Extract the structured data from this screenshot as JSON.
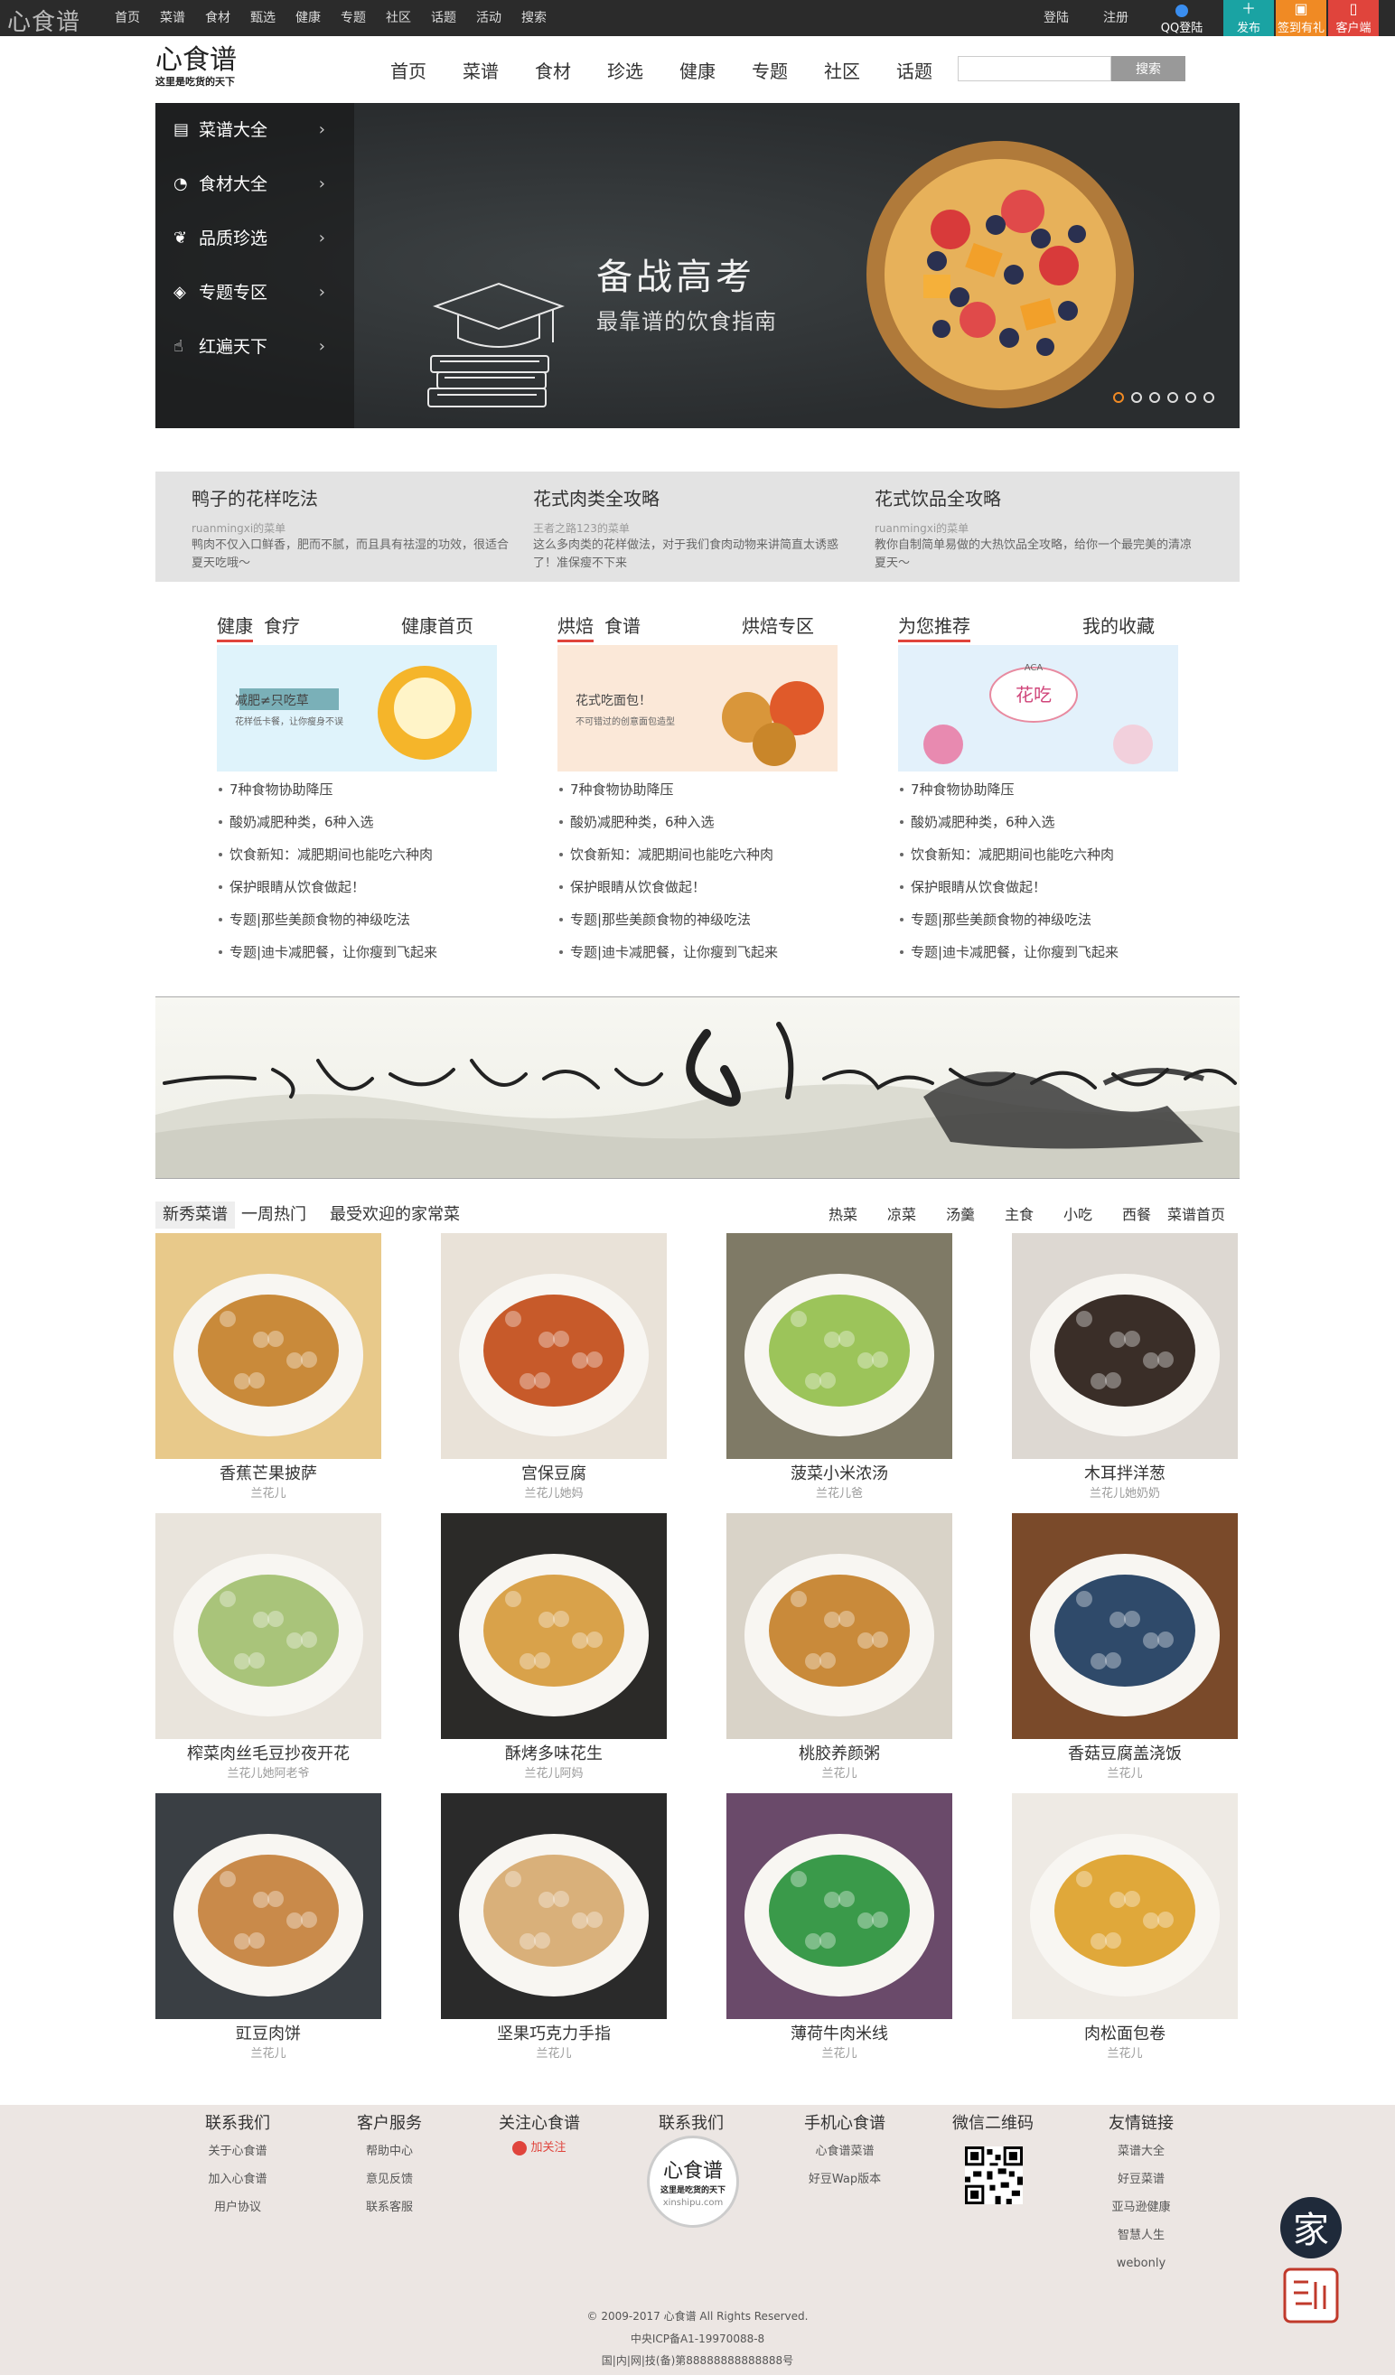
{
  "topbar": {
    "brand": "心食谱",
    "nav": [
      "首页",
      "菜谱",
      "食材",
      "甄选",
      "健康",
      "专题",
      "社区",
      "话题",
      "活动",
      "搜索"
    ],
    "login": "登陆",
    "register": "注册",
    "qq": "QQ登陆",
    "btn_publish": "发布",
    "btn_checkin": "签到有礼",
    "btn_client": "客户端"
  },
  "header": {
    "logo_text": "心食谱",
    "logo_slogan": "这里是吃货的天下",
    "nav": [
      "首页",
      "菜谱",
      "食材",
      "珍选",
      "健康",
      "专题",
      "社区",
      "话题"
    ],
    "search_placeholder": "",
    "search_button": "搜索"
  },
  "hero": {
    "menu": [
      {
        "label": "菜谱大全",
        "icon": "book-icon"
      },
      {
        "label": "食材大全",
        "icon": "apple-icon"
      },
      {
        "label": "品质珍选",
        "icon": "leaf-icon"
      },
      {
        "label": "专题专区",
        "icon": "diamond-icon"
      },
      {
        "label": "红遍天下",
        "icon": "thumbs-up-icon"
      }
    ],
    "title": "备战高考",
    "subtitle": "最靠谱的饮食指南",
    "slides": 6,
    "active_slide": 1
  },
  "articles": [
    {
      "title": "鸭子的花样吃法",
      "author": "ruanmingxi的菜单",
      "desc": "鸭肉不仅入口鲜香，肥而不腻，而且具有祛湿的功效，很适合夏天吃哦～"
    },
    {
      "title": "花式肉类全攻略",
      "author": "王者之路123的菜单",
      "desc": "这么多肉类的花样做法，对于我们食肉动物来讲简直太诱惑了！准保瘦不下来"
    },
    {
      "title": "花式饮品全攻略",
      "author": "ruanmingxi的菜单",
      "desc": "教你自制简单易做的大热饮品全攻略，给你一个最完美的清凉夏天～"
    }
  ],
  "columns": [
    {
      "tabs": [
        "健康",
        "食疗"
      ],
      "more": "健康首页",
      "banner": "减肥≠只吃草",
      "banner_sub": "花样低卡餐，让你瘦身不误",
      "items": [
        "7种食物协助降压",
        "酸奶减肥种类，6种入选",
        "饮食新知：减肥期间也能吃六种肉",
        "保护眼睛从饮食做起！",
        "专题|那些美颜食物的神级吃法",
        "专题|迪卡减肥餐，让你瘦到飞起来"
      ]
    },
    {
      "tabs": [
        "烘焙",
        "食谱"
      ],
      "more": "烘焙专区",
      "banner": "花式吃面包！",
      "banner_sub": "不可错过的创意面包造型",
      "items": [
        "7种食物协助降压",
        "酸奶减肥种类，6种入选",
        "饮食新知：减肥期间也能吃六种肉",
        "保护眼睛从饮食做起！",
        "专题|那些美颜食物的神级吃法",
        "专题|迪卡减肥餐，让你瘦到飞起来"
      ]
    },
    {
      "tabs": [
        "为您推荐"
      ],
      "more": "我的收藏",
      "banner": "花吃",
      "banner_sub": "ACA",
      "items": [
        "7种食物协助降压",
        "酸奶减肥种类，6种入选",
        "饮食新知：减肥期间也能吃六种肉",
        "保护眼睛从饮食做起！",
        "专题|那些美颜食物的神级吃法",
        "专题|迪卡减肥餐，让你瘦到飞起来"
      ]
    }
  ],
  "recipes_tabs": {
    "left": [
      "新秀菜谱",
      "一周热门",
      "最受欢迎的家常菜"
    ],
    "right": [
      "热菜",
      "凉菜",
      "汤羹",
      "主食",
      "小吃",
      "西餐",
      "菜谱首页"
    ]
  },
  "recipes": [
    {
      "name": "香蕉芒果披萨",
      "author": "兰花儿",
      "bg": "#e8c98a",
      "fg": "#c98a3a"
    },
    {
      "name": "宫保豆腐",
      "author": "兰花儿她妈",
      "bg": "#e9e2d8",
      "fg": "#c75a2a"
    },
    {
      "name": "菠菜小米浓汤",
      "author": "兰花儿爸",
      "bg": "#7f7a66",
      "fg": "#9cc45a"
    },
    {
      "name": "木耳拌洋葱",
      "author": "兰花儿她奶奶",
      "bg": "#ddd8d2",
      "fg": "#3a2e28"
    },
    {
      "name": "榨菜肉丝毛豆抄夜开花",
      "author": "兰花儿她阿老爷",
      "bg": "#e9e4dc",
      "fg": "#a9c47a"
    },
    {
      "name": "酥烤多味花生",
      "author": "兰花儿阿妈",
      "bg": "#2b2a28",
      "fg": "#d9a24a"
    },
    {
      "name": "桃胶养颜粥",
      "author": "兰花儿",
      "bg": "#d9d3c8",
      "fg": "#c98a3a"
    },
    {
      "name": "香菇豆腐盖浇饭",
      "author": "兰花儿",
      "bg": "#7a4a2a",
      "fg": "#2f4a6a"
    },
    {
      "name": "豇豆肉饼",
      "author": "兰花儿",
      "bg": "#3a3f44",
      "fg": "#c98a4a"
    },
    {
      "name": "坚果巧克力手指",
      "author": "兰花儿",
      "bg": "#2a2a2a",
      "fg": "#d9b07a"
    },
    {
      "name": "薄荷牛肉米线",
      "author": "兰花儿",
      "bg": "#6a4a6a",
      "fg": "#3a9a4a"
    },
    {
      "name": "肉松面包卷",
      "author": "兰花儿",
      "bg": "#eeeae4",
      "fg": "#e0a83a"
    }
  ],
  "footer": {
    "cols": [
      {
        "title": "联系我们",
        "links": [
          "关于心食谱",
          "加入心食谱",
          "用户协议"
        ]
      },
      {
        "title": "客户服务",
        "links": [
          "帮助中心",
          "意见反馈",
          "联系客服"
        ]
      },
      {
        "title": "关注心食谱",
        "follow": "加关注"
      },
      {
        "title": "联系我们",
        "links": []
      },
      {
        "title": "手机心食谱",
        "links": [
          "心食谱菜谱",
          "好豆Wap版本"
        ]
      },
      {
        "title": "微信二维码",
        "links": []
      },
      {
        "title": "友情链接",
        "links": [
          "菜谱大全",
          "好豆菜谱",
          "亚马逊健康",
          "智慧人生",
          "webonly"
        ]
      }
    ],
    "circle_logo": "心食谱",
    "circle_slogan": "这里是吃货的天下",
    "circle_url": "xinshipu.com",
    "copyright": "© 2009-2017 心食谱 All Rights Reserved.",
    "icp": "中央ICP备A1-19970088-8",
    "record": "国|内|网|技(备)第88888888888888号",
    "stamp": "家"
  }
}
